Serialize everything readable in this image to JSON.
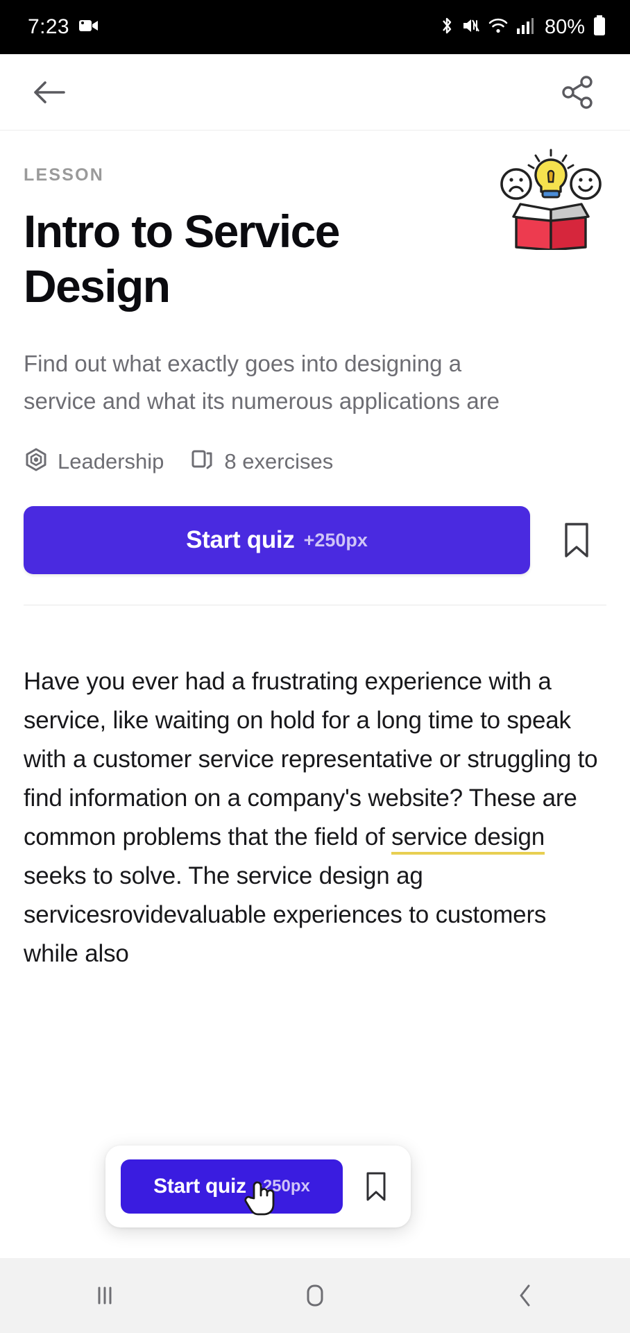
{
  "status_bar": {
    "time": "7:23",
    "battery_percent": "80%",
    "icons": [
      "video-record-icon",
      "bluetooth-icon",
      "mute-icon",
      "wifi-icon",
      "cellular-signal-icon",
      "battery-icon"
    ]
  },
  "app_bar": {
    "back_icon": "back-arrow-icon",
    "share_icon": "share-icon"
  },
  "lesson": {
    "eyebrow": "LESSON",
    "title": "Intro to Service Design",
    "subtitle": "Find out what exactly goes into designing a service and what its numerous applications are",
    "illustration": "lightbulb-in-box-illustration",
    "meta": [
      {
        "icon": "leadership-gear-icon",
        "label": "Leadership"
      },
      {
        "icon": "exercises-cards-icon",
        "label": "8 exercises"
      }
    ],
    "cta": {
      "label": "Start quiz",
      "bonus": "+250px",
      "color": "#4a2ae0",
      "bookmark_icon": "bookmark-icon"
    }
  },
  "article": {
    "part1": "Have you ever had a frustrating experience with a service, like waiting on hold for a long time to speak with a customer service representative or struggling to find information on a company's website? These are common problems that the field of ",
    "highlight": "service design",
    "highlight_color": "#e8cf52",
    "part2": " seeks to solve. The service design a",
    "part3": "g services",
    "part4": "rovide",
    "part5": "valuable experiences to customers while also"
  },
  "floating_card": {
    "label": "Start quiz",
    "bonus": "+250px",
    "color": "#3a1ce0",
    "bookmark_icon": "bookmark-icon",
    "cursor": "hand-pointer-cursor"
  },
  "nav_bar": {
    "recents_icon": "recents-icon",
    "home_icon": "home-icon",
    "back_icon": "nav-back-icon"
  }
}
